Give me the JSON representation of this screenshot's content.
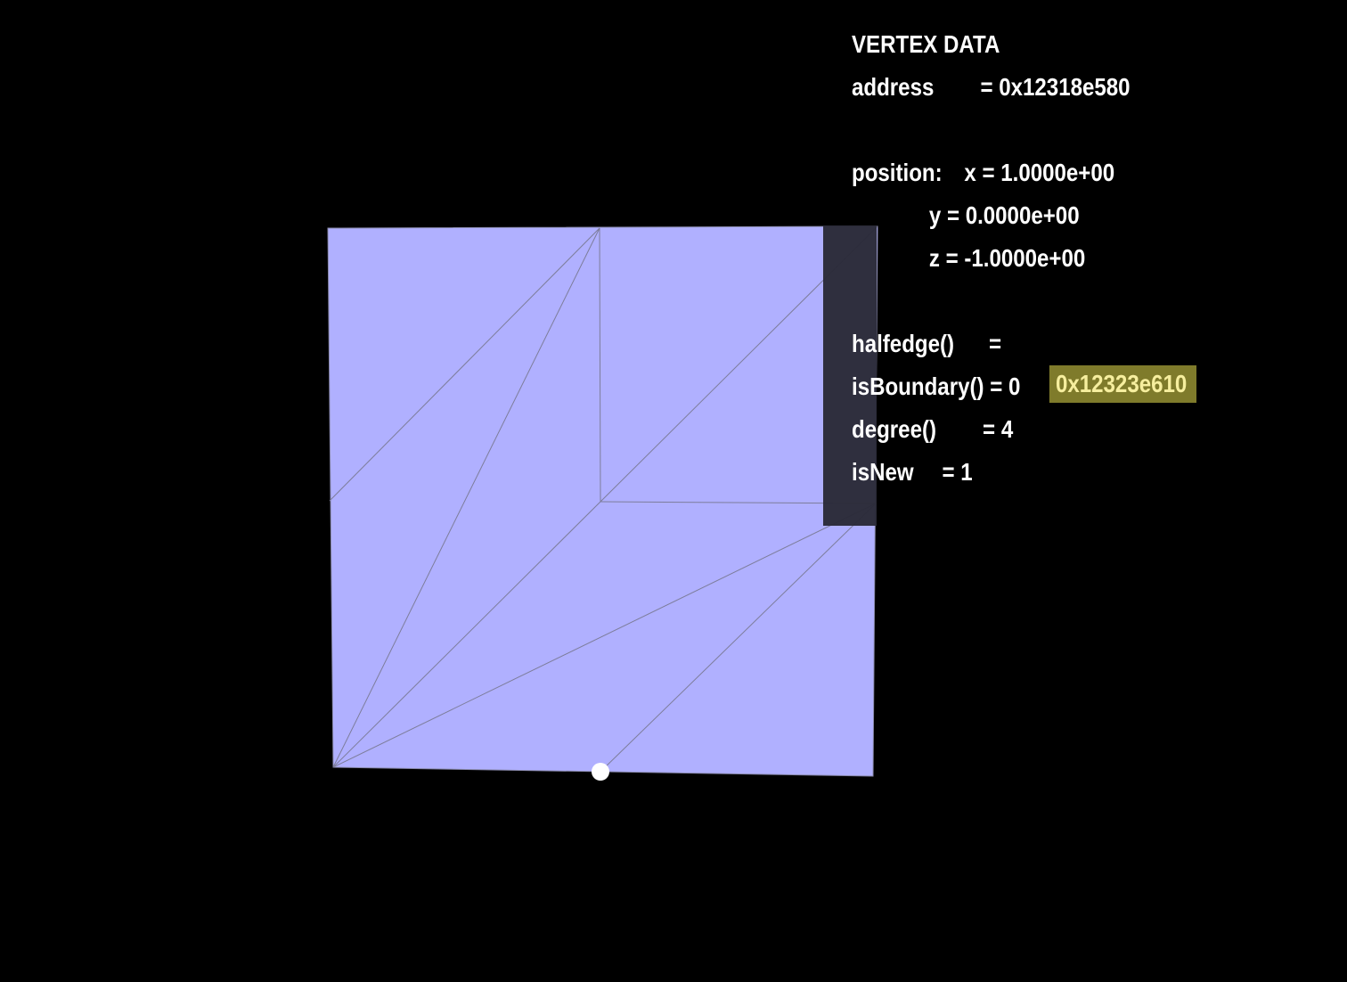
{
  "viewport": {
    "background_color": "#000000",
    "mesh_fill_color": "#b0b0ff",
    "edge_color": "#7d7d9a",
    "selected_vertex_color": "#ffffff"
  },
  "vertex_data": {
    "heading": "VERTEX DATA",
    "address_label": "address",
    "address_value": "= 0x12318e580",
    "position_label": "position:",
    "x_value": "x = 1.0000e+00",
    "y_value": "y = 0.0000e+00",
    "z_value": "z = -1.0000e+00",
    "halfedge_label": "halfedge()",
    "halfedge_eq": "=",
    "halfedge_value": "0x12323e610",
    "halfedge_highlight_color": "#7f7b2b",
    "isboundary_text": "isBoundary() = 0",
    "degree_label": "degree()",
    "degree_value": "= 4",
    "isnew_label": "isNew",
    "isnew_value": "= 1"
  }
}
